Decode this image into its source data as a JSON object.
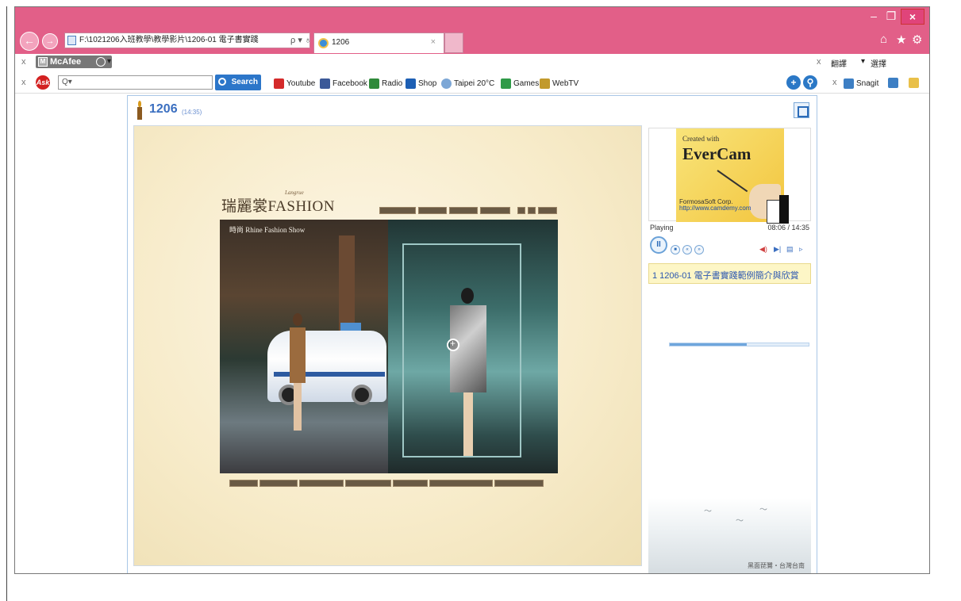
{
  "window": {
    "minimize_icon": "–",
    "maximize_icon": "❐",
    "close_icon": "×"
  },
  "browser": {
    "address": "F:\\1021206入班教學\\教學影片\\1206-01 電子書實踐",
    "address_tools": "ρ ▾ ♁",
    "tab_title": "1206",
    "tab_close": "×",
    "right_icons": [
      "⌂",
      "★",
      "⚙"
    ]
  },
  "toolbar1": {
    "mcafee_label": "McAfee",
    "right_items": [
      "翻譯",
      "選擇"
    ]
  },
  "toolbar2": {
    "ask_label": "Ask",
    "search_placeholder": "Q▾",
    "search_button": "Search",
    "links": [
      {
        "label": "Youtube",
        "color": "#d42a2a"
      },
      {
        "label": "Facebook",
        "color": "#3b5998"
      },
      {
        "label": "Radio",
        "color": "#2f8a3a"
      },
      {
        "label": "Shop",
        "color": "#1d5fb4"
      },
      {
        "label": "Taipei 20°C",
        "color": "#7da7d6"
      },
      {
        "label": "Games",
        "color": "#2f9a48"
      },
      {
        "label": "WebTV",
        "color": "#c29a2c"
      }
    ],
    "snagit_label": "Snagit"
  },
  "player": {
    "title": "1206",
    "duration": "(14:35)",
    "status": "Playing",
    "time": "08:06 / 14:35",
    "progress": 0.556,
    "chapter": "1 1206-01 電子書實踐範例簡介與欣賞"
  },
  "evercam": {
    "created_with": "Created with",
    "title": "EverCam",
    "company": "FormosaSoft Corp.",
    "url": "http://www.camdemy.com"
  },
  "slide": {
    "brand": "瑞麗裳FASHION",
    "brand_sub": "Langrue",
    "photo_text": "時尚 Rhine Fashion Show"
  },
  "deco": {
    "caption": "黑面琵鷺・台灣台南"
  }
}
